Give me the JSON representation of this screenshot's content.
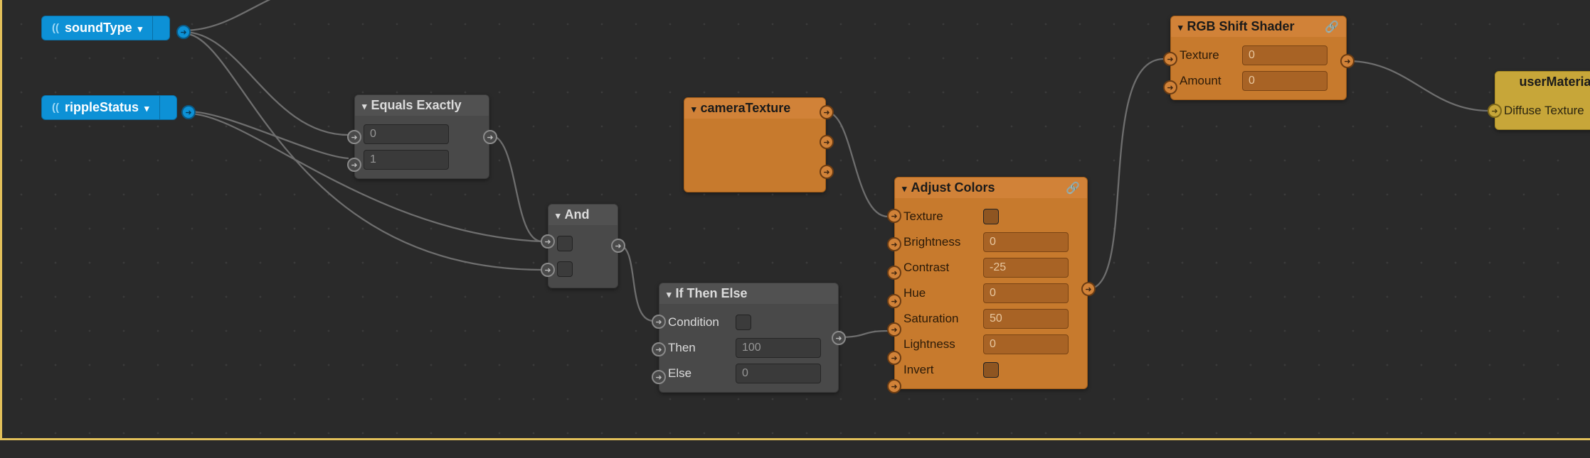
{
  "nodes": {
    "soundType": {
      "title": "soundType"
    },
    "rippleStatus": {
      "title": "rippleStatus"
    },
    "equals": {
      "title": "Equals Exactly",
      "input1": "0",
      "input2": "1"
    },
    "and": {
      "title": "And"
    },
    "ifThenElse": {
      "title": "If Then Else",
      "rows": {
        "condition": "Condition",
        "then": "Then",
        "else": "Else"
      },
      "values": {
        "then": "100",
        "else": "0"
      }
    },
    "cameraTexture": {
      "title": "cameraTexture"
    },
    "adjustColors": {
      "title": "Adjust Colors",
      "rows": {
        "texture": "Texture",
        "brightness": "Brightness",
        "contrast": "Contrast",
        "hue": "Hue",
        "saturation": "Saturation",
        "lightness": "Lightness",
        "invert": "Invert"
      },
      "values": {
        "brightness": "0",
        "contrast": "-25",
        "hue": "0",
        "saturation": "50",
        "lightness": "0"
      }
    },
    "rgbShift": {
      "title": "RGB Shift Shader",
      "rows": {
        "texture": "Texture",
        "amount": "Amount"
      },
      "values": {
        "texture": "0",
        "amount": "0"
      }
    },
    "userMaterial": {
      "title": "userMaterial",
      "rows": {
        "diffuse": "Diffuse Texture"
      }
    }
  }
}
